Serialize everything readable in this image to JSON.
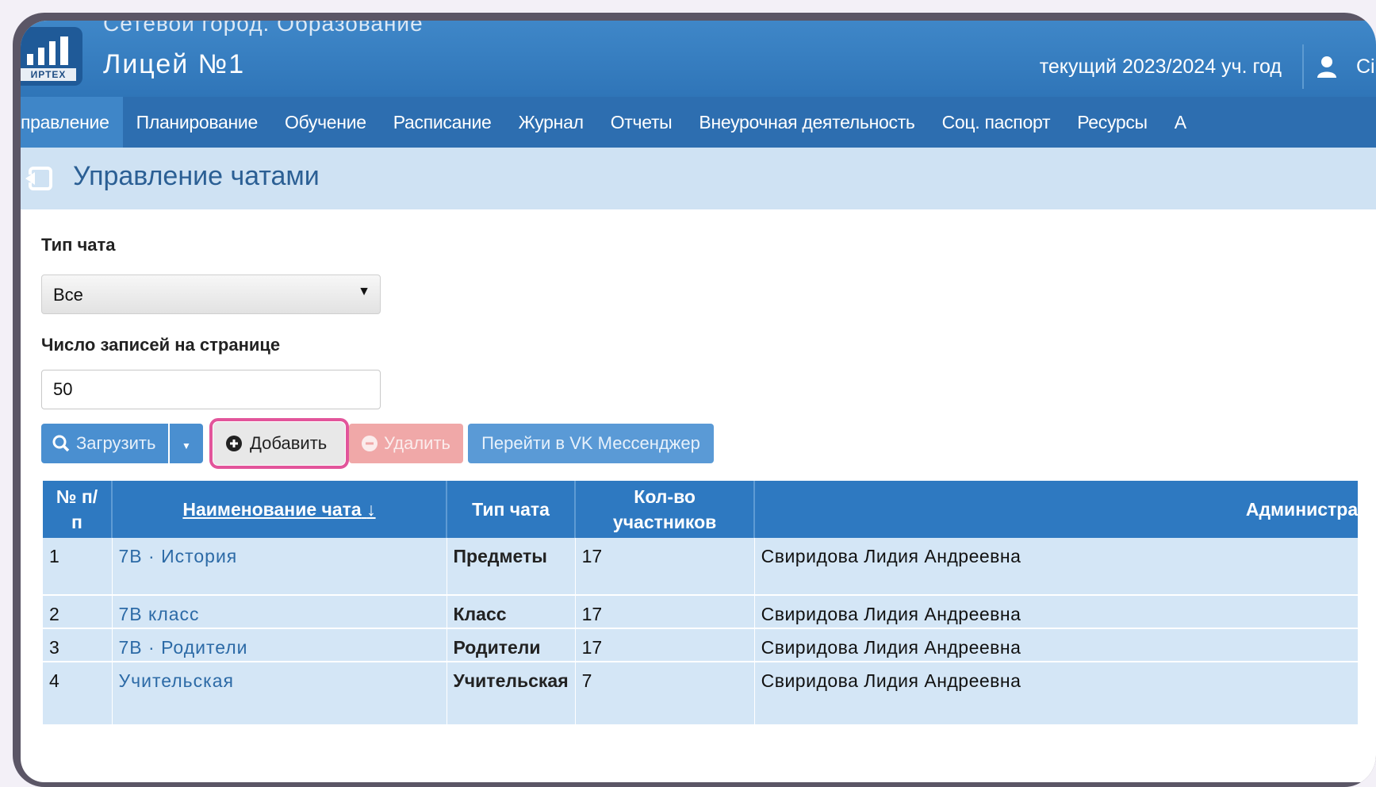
{
  "header": {
    "system_name": "Сетевой город. Образование",
    "school_name": "Лицей №1",
    "year": "текущий 2023/2024 уч. год",
    "user_label": "Сі",
    "logo_text": "ИРТЕХ"
  },
  "menu": [
    {
      "label": "правление"
    },
    {
      "label": "Планирование"
    },
    {
      "label": "Обучение"
    },
    {
      "label": "Расписание"
    },
    {
      "label": "Журнал"
    },
    {
      "label": "Отчеты"
    },
    {
      "label": "Внеурочная деятельность"
    },
    {
      "label": "Соц. паспорт"
    },
    {
      "label": "Ресурсы"
    },
    {
      "label": "А"
    }
  ],
  "page": {
    "title": "Управление чатами"
  },
  "filters": {
    "chat_type_label": "Тип чата",
    "chat_type_value": "Все",
    "per_page_label": "Число записей на странице",
    "per_page_value": "50"
  },
  "toolbar": {
    "load_label": "Загрузить",
    "add_label": "Добавить",
    "delete_label": "Удалить",
    "vk_label": "Перейти в VK Мессенджер"
  },
  "table": {
    "headers": {
      "num_line1": "№ п/",
      "num_line2": "п",
      "name": "Наименование чата",
      "sort_arrow": "↓",
      "type": "Тип чата",
      "count_line1": "Кол-во",
      "count_line2": "участников",
      "admin": "Администра"
    },
    "rows": [
      {
        "num": "1",
        "name": "7В · История",
        "type": "Предметы",
        "count": "17",
        "admin": "Свиридова Лидия Андреевна"
      },
      {
        "num": "2",
        "name": "7В класс",
        "type": "Класс",
        "count": "17",
        "admin": "Свиридова Лидия Андреевна"
      },
      {
        "num": "3",
        "name": "7В · Родители",
        "type": "Родители",
        "count": "17",
        "admin": "Свиридова Лидия Андреевна"
      },
      {
        "num": "4",
        "name": "Учительская",
        "type": "Учительская",
        "count": "7",
        "admin": "Свиридова Лидия Андреевна"
      }
    ]
  },
  "icons": {
    "load": "search-icon",
    "add": "plus-circle-icon",
    "delete": "minus-circle-icon",
    "user": "user-icon",
    "back": "back-icon"
  },
  "colors": {
    "header_blue": "#3f87c8",
    "menu_blue": "#2d6eb0",
    "highlight": "#e2559b",
    "row_bg": "#d4e6f6"
  }
}
